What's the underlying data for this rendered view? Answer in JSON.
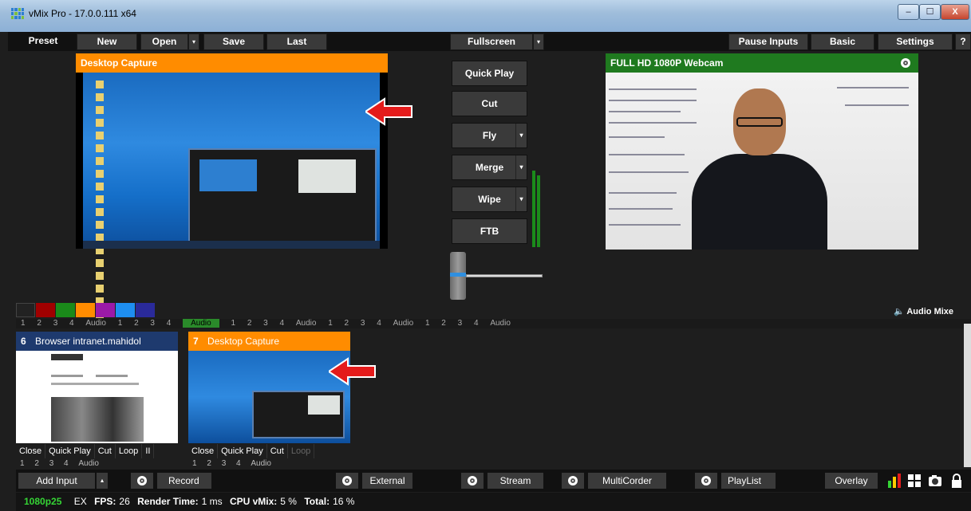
{
  "window": {
    "title": "vMix Pro - 17.0.0.111 x64",
    "controls": [
      "–",
      "☐",
      "X"
    ]
  },
  "toolbar": {
    "preset": "Preset",
    "new": "New",
    "open": "Open",
    "save": "Save",
    "last": "Last",
    "fullscreen": "Fullscreen",
    "pause_inputs": "Pause Inputs",
    "basic": "Basic",
    "settings": "Settings",
    "help": "?"
  },
  "preview": {
    "title": "Desktop Capture",
    "header_color": "#ff8c00"
  },
  "transitions": {
    "quick_play": "Quick Play",
    "cut": "Cut",
    "fly": "Fly",
    "merge": "Merge",
    "wipe": "Wipe",
    "ftb": "FTB"
  },
  "output": {
    "title": "FULL HD 1080P Webcam",
    "header_color": "#1f7a1f"
  },
  "colors": {
    "swatches": [
      "#222222",
      "#a00000",
      "#1a8a1a",
      "#ff8c00",
      "#9b1aa8",
      "#1e8ef0",
      "#2a2a9a"
    ]
  },
  "audio_mixer": {
    "label": "Audio Mixe"
  },
  "tab_row": {
    "items": [
      "1",
      "2",
      "3",
      "4",
      "Audio",
      "1",
      "2",
      "3",
      "4",
      "Audio",
      "1",
      "2",
      "3",
      "4",
      "Audio",
      "1",
      "2",
      "3",
      "4",
      "Audio",
      "1",
      "2",
      "3",
      "4",
      "Audio"
    ]
  },
  "inputs": [
    {
      "number": "6",
      "title": "Browser intranet.mahidol",
      "header_color": "#1e3a6e",
      "buttons": [
        "Close",
        "Quick Play",
        "Cut",
        "Loop",
        "II"
      ],
      "footer": [
        "1",
        "2",
        "3",
        "4",
        "Audio"
      ]
    },
    {
      "number": "7",
      "title": "Desktop Capture",
      "header_color": "#ff8c00",
      "buttons": [
        "Close",
        "Quick Play",
        "Cut",
        "Loop"
      ],
      "footer": [
        "1",
        "2",
        "3",
        "4",
        "Audio"
      ]
    }
  ],
  "bottom_bar": {
    "add_input": "Add Input",
    "record": "Record",
    "external": "External",
    "stream": "Stream",
    "multicorder": "MultiCorder",
    "playlist": "PlayList",
    "overlay": "Overlay"
  },
  "status": {
    "format": "1080p25",
    "ex": "EX",
    "fps_label": "FPS:",
    "fps": "26",
    "render_label": "Render Time:",
    "render": "1 ms",
    "cpu_label": "CPU vMix:",
    "cpu": "5 %",
    "total_label": "Total:",
    "total": "16 %"
  }
}
